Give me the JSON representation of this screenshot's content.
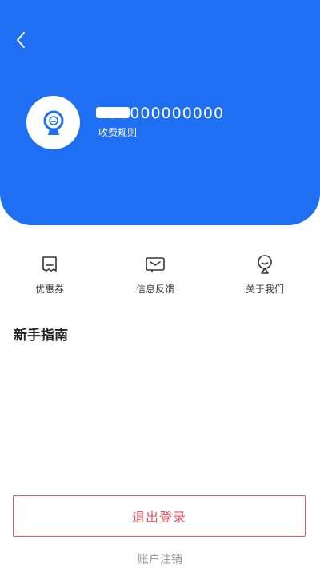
{
  "header": {
    "phone_number": "130000000000",
    "fee_rules_label": "收费规则",
    "color": "#1f6ff2"
  },
  "menu": {
    "items": [
      {
        "label": "优惠券",
        "icon": "coupon-icon"
      },
      {
        "label": "信息反馈",
        "icon": "feedback-icon"
      },
      {
        "label": "关于我们",
        "icon": "about-us-icon"
      }
    ]
  },
  "guide": {
    "title": "新手指南"
  },
  "footer": {
    "logout_label": "退出登录",
    "cancel_account_label": "账户注销",
    "logout_color": "#e8595f"
  }
}
